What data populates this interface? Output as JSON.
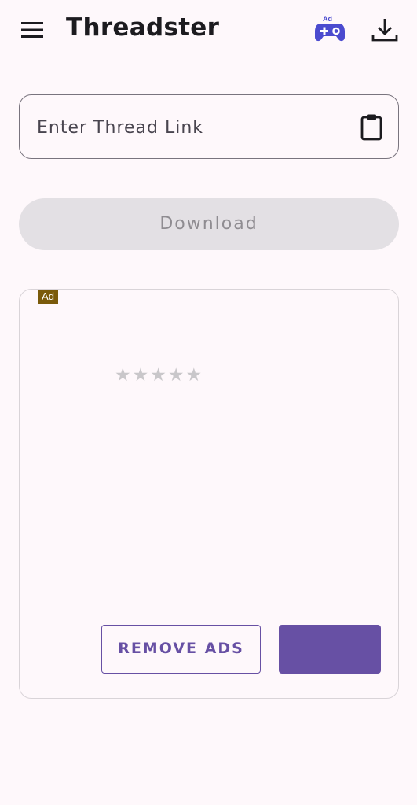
{
  "app_bar": {
    "title": "Threadster",
    "game_ad_label": "Ad",
    "icons": [
      "menu-icon",
      "gamepad-icon",
      "download-icon"
    ]
  },
  "link_input": {
    "placeholder": "Enter Thread Link",
    "value": "",
    "trailing_icon": "clipboard-icon"
  },
  "download_button": {
    "label": "Download",
    "enabled": false
  },
  "ad_card": {
    "badge": "Ad",
    "rating_stars": [
      "★",
      "★",
      "★",
      "★",
      "★"
    ],
    "rating_value": 0,
    "remove_ads_label": "REMOVE ADS",
    "cta_label": ""
  },
  "colors": {
    "background": "#fef8fb",
    "primary": "#6750a4",
    "disabled_button": "#e3e0e4",
    "ad_badge": "#7a5a0a",
    "game_icon": "#4b4bcf"
  }
}
